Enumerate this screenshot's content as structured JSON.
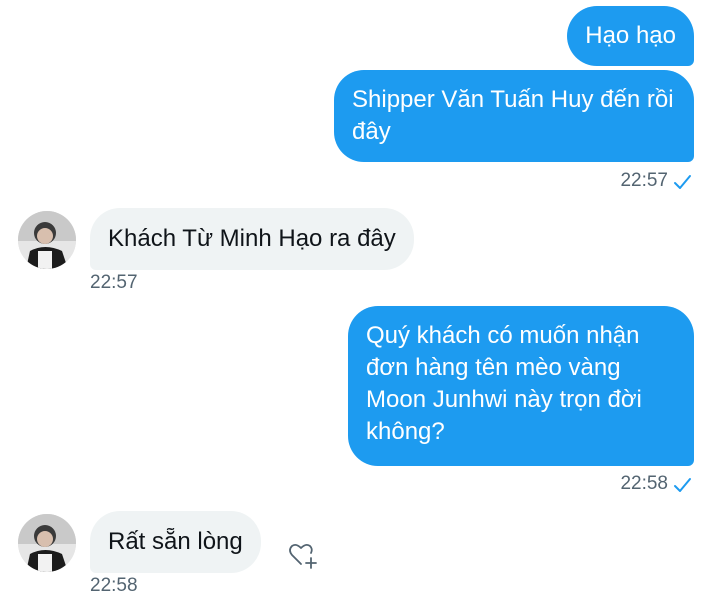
{
  "messages": [
    {
      "direction": "outgoing",
      "text": "Hạo hạo"
    },
    {
      "direction": "outgoing",
      "text": "Shipper Văn Tuấn Huy đến rồi đây",
      "time": "22:57",
      "status": "sent"
    },
    {
      "direction": "incoming",
      "text": "Khách Từ Minh Hạo ra đây",
      "time": "22:57"
    },
    {
      "direction": "outgoing",
      "text": "Quý khách có muốn nhận đơn hàng tên mèo vàng Moon Junhwi này trọn đời không?",
      "time": "22:58",
      "status": "sent"
    },
    {
      "direction": "incoming",
      "text": "Rất sẵn lòng",
      "time": "22:58"
    }
  ],
  "colors": {
    "outgoing_bubble": "#1d9bf0",
    "incoming_bubble": "#eff3f4",
    "timestamp": "#536471",
    "check": "#1d9bf0"
  },
  "icons": {
    "check": "check-icon",
    "reaction": "add-reaction-heart-icon",
    "avatar": "user-avatar"
  }
}
